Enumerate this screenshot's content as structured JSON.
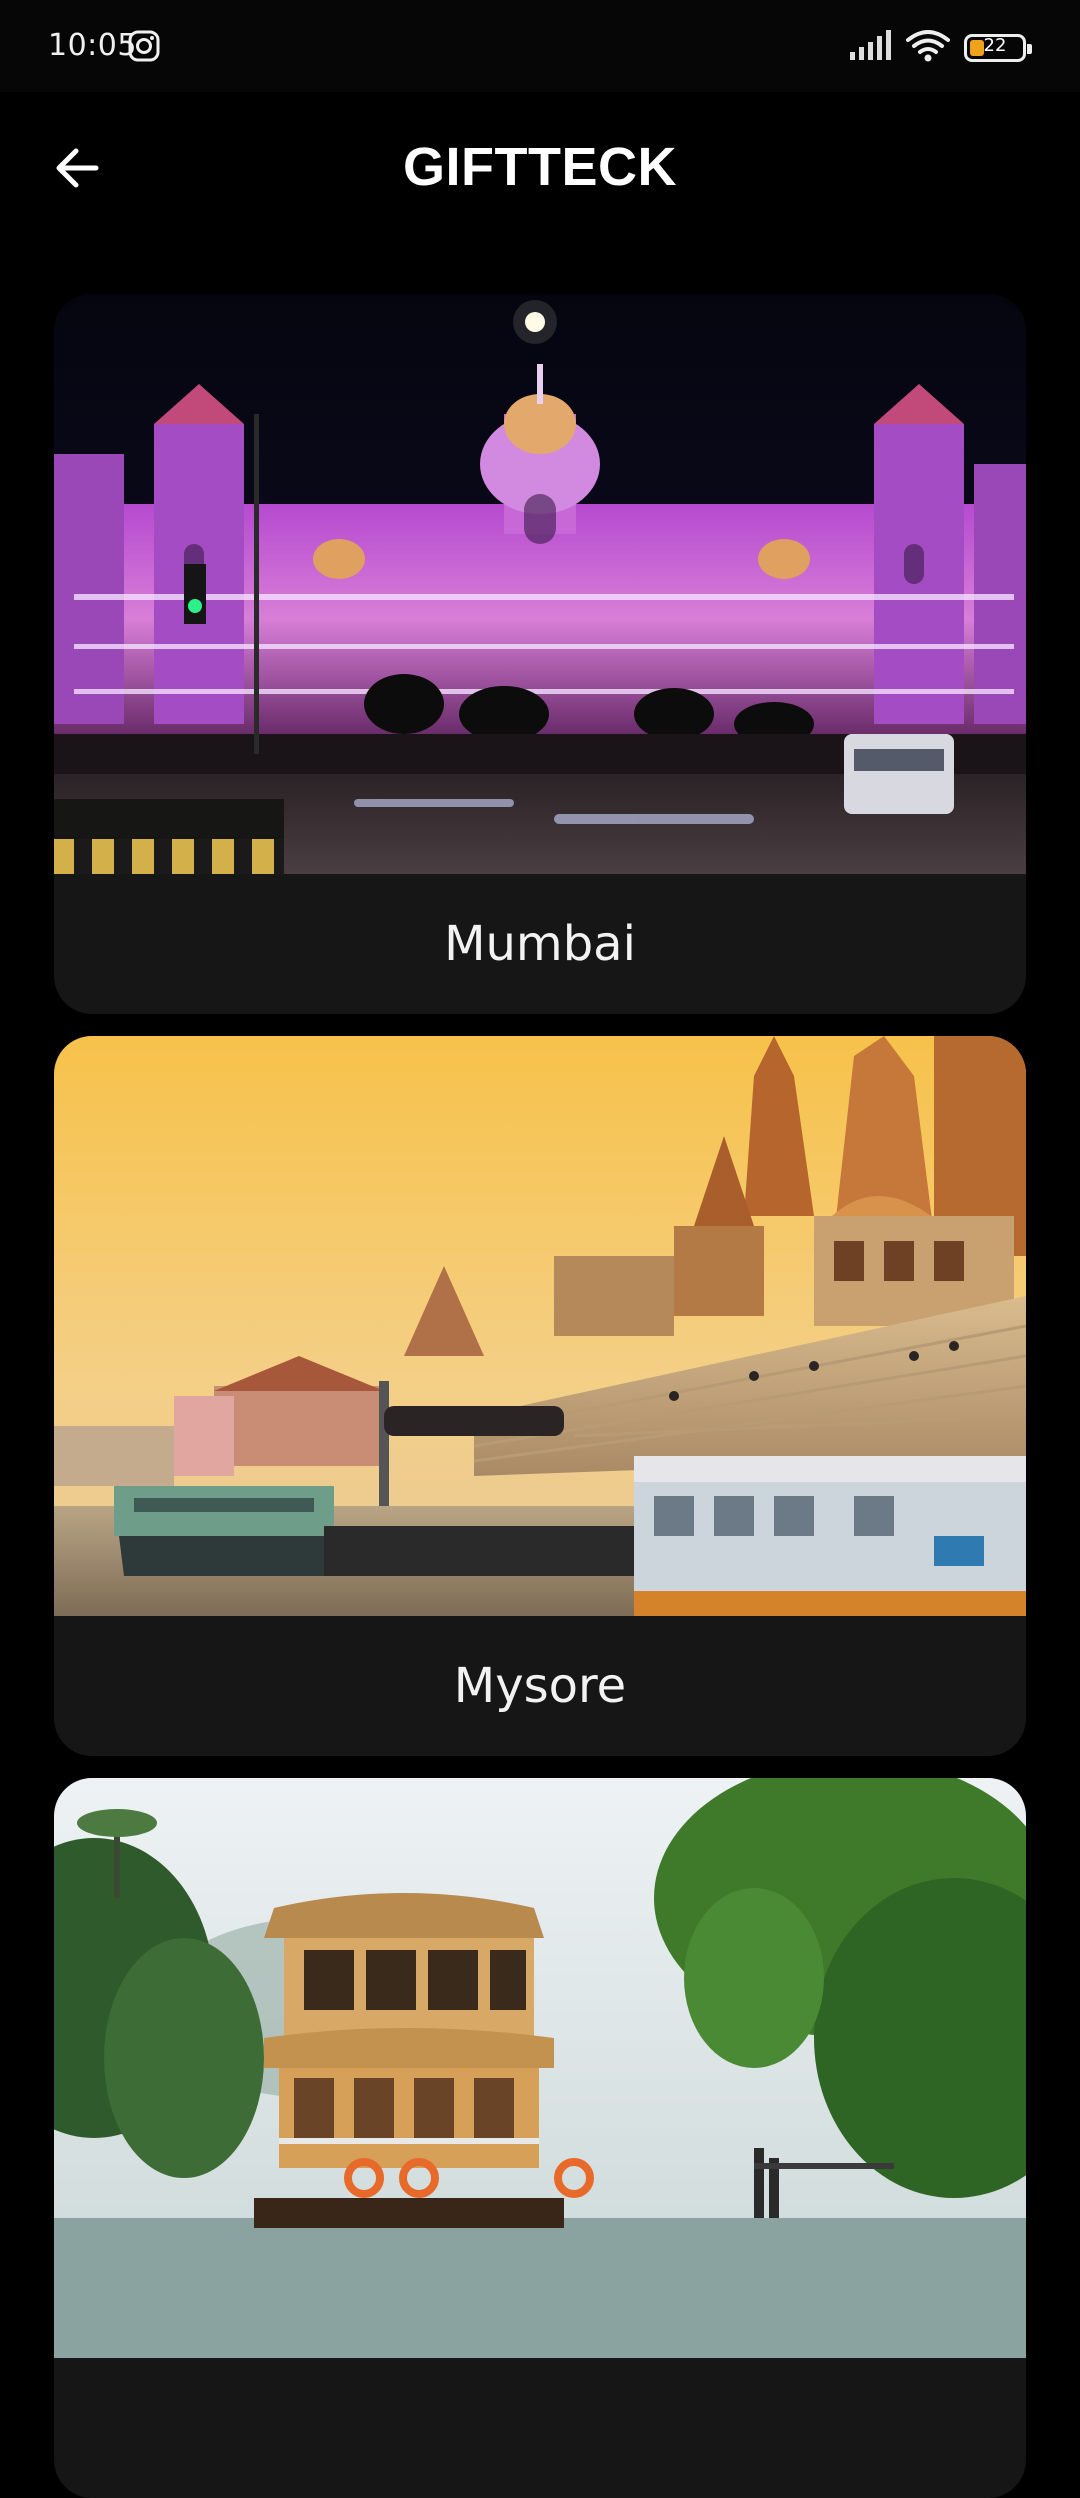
{
  "status_bar": {
    "time": "10:05",
    "battery_level": "22",
    "icons": [
      "instagram-icon",
      "signal-icon",
      "wifi-icon",
      "battery-icon"
    ]
  },
  "header": {
    "title": "GIFTTECK",
    "back_icon": "arrow-left-icon"
  },
  "cities": [
    {
      "name": "Mumbai"
    },
    {
      "name": "Mysore"
    },
    {
      "name": ""
    }
  ],
  "colors": {
    "background": "#000000",
    "card": "#161616",
    "battery_accent": "#f0a21a"
  }
}
